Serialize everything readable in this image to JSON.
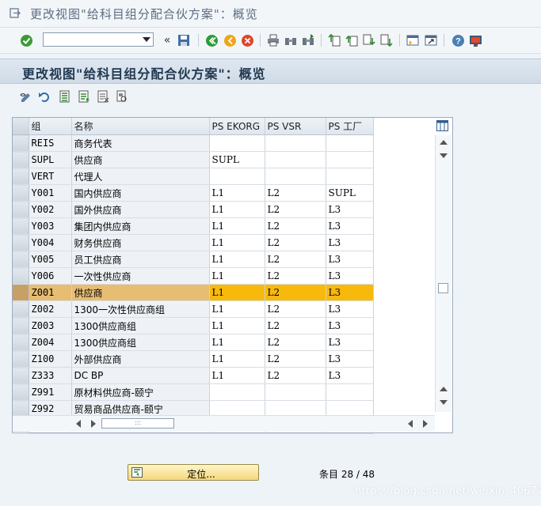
{
  "window": {
    "title": "更改视图\"给科目组分配合伙方案\"：概览"
  },
  "header": {
    "title": "更改视图\"给科目组分配合伙方案\"：概览"
  },
  "toolbar": {
    "command_value": "",
    "icons": [
      "check-icon",
      "command-dropdown-icon",
      "back-double-arrow-icon",
      "save-icon",
      "back-icon",
      "exit-icon",
      "cancel-icon",
      "print-icon",
      "find-icon",
      "find-next-icon",
      "first-page-icon",
      "previous-page-icon",
      "next-page-icon",
      "last-page-icon",
      "new-session-icon",
      "shortcut-icon",
      "help-icon",
      "customize-layout-icon"
    ]
  },
  "app_toolbar": {
    "icons": [
      "change-display-icon",
      "undo-icon",
      "select-all-icon",
      "select-block-icon",
      "deselect-all-icon",
      "print-preview-icon"
    ]
  },
  "table": {
    "columns": [
      "组",
      "名称",
      "PS EKORG",
      "PS VSR",
      "PS 工厂"
    ],
    "rows": [
      {
        "key": "REIS",
        "name": "商务代表",
        "ekorg": "",
        "vsr": "",
        "plant": ""
      },
      {
        "key": "SUPL",
        "name": "供应商",
        "ekorg": "SUPL",
        "vsr": "",
        "plant": ""
      },
      {
        "key": "VERT",
        "name": "代理人",
        "ekorg": "",
        "vsr": "",
        "plant": ""
      },
      {
        "key": "Y001",
        "name": "国内供应商",
        "ekorg": "L1",
        "vsr": "L2",
        "plant": "SUPL"
      },
      {
        "key": "Y002",
        "name": "国外供应商",
        "ekorg": "L1",
        "vsr": "L2",
        "plant": "L3"
      },
      {
        "key": "Y003",
        "name": "集团内供应商",
        "ekorg": "L1",
        "vsr": "L2",
        "plant": "L3"
      },
      {
        "key": "Y004",
        "name": "财务供应商",
        "ekorg": "L1",
        "vsr": "L2",
        "plant": "L3"
      },
      {
        "key": "Y005",
        "name": "员工供应商",
        "ekorg": "L1",
        "vsr": "L2",
        "plant": "L3"
      },
      {
        "key": "Y006",
        "name": "一次性供应商",
        "ekorg": "L1",
        "vsr": "L2",
        "plant": "L3"
      },
      {
        "key": "Z001",
        "name": "供应商",
        "ekorg": "L1",
        "vsr": "L2",
        "plant": "L3",
        "highlight": true
      },
      {
        "key": "Z002",
        "name": "1300一次性供应商组",
        "ekorg": "L1",
        "vsr": "L2",
        "plant": "L3"
      },
      {
        "key": "Z003",
        "name": "1300供应商组",
        "ekorg": "L1",
        "vsr": "L2",
        "plant": "L3"
      },
      {
        "key": "Z004",
        "name": "1300供应商组",
        "ekorg": "L1",
        "vsr": "L2",
        "plant": "L3"
      },
      {
        "key": "Z100",
        "name": "外部供应商",
        "ekorg": "L1",
        "vsr": "L2",
        "plant": "L3"
      },
      {
        "key": "Z333",
        "name": "DC BP",
        "ekorg": "L1",
        "vsr": "L2",
        "plant": "L3"
      },
      {
        "key": "Z991",
        "name": "原材料供应商-颐宁",
        "ekorg": "",
        "vsr": "",
        "plant": ""
      },
      {
        "key": "Z992",
        "name": "贸易商品供应商-颐宁",
        "ekorg": "",
        "vsr": "",
        "plant": ""
      }
    ]
  },
  "footer": {
    "position_button": "定位...",
    "entry_label": "条目 28 / 48"
  },
  "watermark": "https://blog.csdn.net/weixin_40672823",
  "colors": {
    "highlight_row": "#f8b90d",
    "header_band": "#cfdbe7"
  }
}
